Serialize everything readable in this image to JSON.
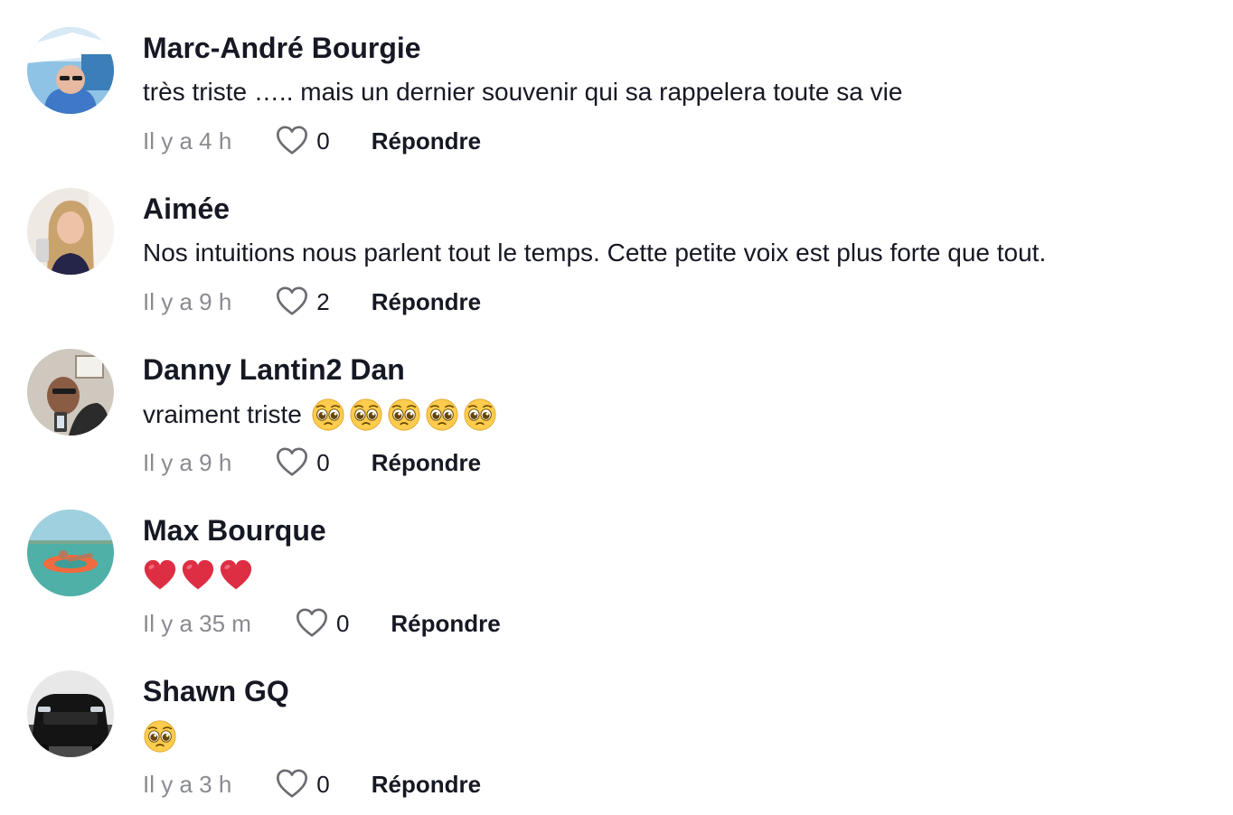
{
  "comments": [
    {
      "username": "Marc-André Bourgie",
      "text": "très triste ….. mais un dernier souvenir qui sa rappelera toute sa vie",
      "time": "Il y a 4 h",
      "likes": "0",
      "reply_label": "Répondre"
    },
    {
      "username": "Aimée",
      "text": "Nos intuitions nous parlent tout le temps. Cette petite voix est plus forte que tout.",
      "time": "Il y a 9 h",
      "likes": "2",
      "reply_label": "Répondre"
    },
    {
      "username": "Danny Lantin2 Dan",
      "text": "vraiment triste",
      "emojis": [
        "pleading-face",
        "pleading-face",
        "pleading-face",
        "pleading-face",
        "pleading-face"
      ],
      "time": "Il y a 9 h",
      "likes": "0",
      "reply_label": "Répondre"
    },
    {
      "username": "Max Bourque",
      "text": "",
      "emojis": [
        "red-heart",
        "red-heart",
        "red-heart"
      ],
      "time": "Il y a 35 m",
      "likes": "0",
      "reply_label": "Répondre"
    },
    {
      "username": "Shawn GQ",
      "text": "",
      "emojis": [
        "pleading-face"
      ],
      "time": "Il y a 3 h",
      "likes": "0",
      "reply_label": "Répondre"
    }
  ],
  "icons": {
    "like": "heart-outline-icon"
  },
  "colors": {
    "text": "#161823",
    "muted": "#8a8b91",
    "background": "#ffffff"
  }
}
